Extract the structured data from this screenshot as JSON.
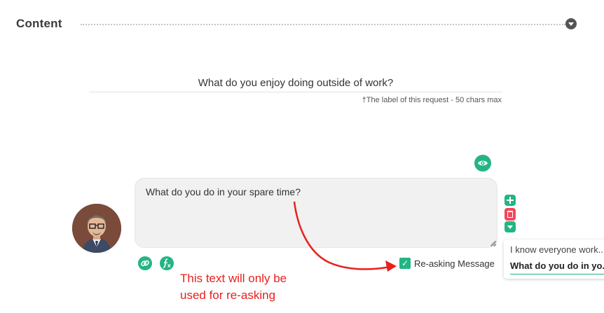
{
  "section": {
    "title": "Content"
  },
  "label": {
    "value": "What do you enjoy doing outside of work?",
    "hint": "†The label of this request - 50 chars max"
  },
  "message": {
    "value": "What do you do in your spare time?"
  },
  "reasking": {
    "label": "Re-asking Message",
    "checked": true
  },
  "annotation": {
    "line1": "This text will only be",
    "line2": "used for re-asking"
  },
  "variants": [
    {
      "text": "I know everyone work..."
    },
    {
      "text": "What do you do in yo..."
    }
  ],
  "icons": {
    "collapse": "chevron-down-icon",
    "preview": "eye-icon",
    "add": "plus-icon",
    "delete": "trash-icon",
    "move_down": "chevron-down-icon",
    "link": "link-icon",
    "function": "fx-icon",
    "checkbox": "checkmark-icon"
  },
  "colors": {
    "accent": "#23b583",
    "danger": "#f0485a",
    "annotation": "#e8201e"
  }
}
